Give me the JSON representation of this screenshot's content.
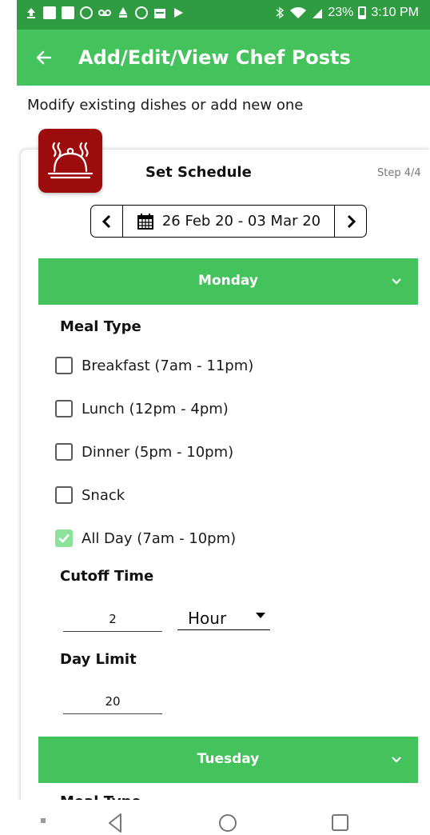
{
  "status_bar": {
    "battery": "23%",
    "time": "3:10 PM",
    "icons": [
      "upload-icon",
      "youtube-icon",
      "youtube-icon",
      "whatsapp-icon",
      "voicemail-icon",
      "app-icon",
      "smiley-icon",
      "calendar-icon",
      "play-store-icon",
      "bluetooth-icon",
      "wifi-icon",
      "signal-icon",
      "battery-icon"
    ]
  },
  "app_bar": {
    "title": "Add/Edit/View Chef Posts",
    "back_icon": "arrow-left-icon"
  },
  "subtitle": "Modify existing dishes or add new one",
  "card": {
    "logo_icon": "food-cloche-icon",
    "title": "Set Schedule",
    "step": "Step 4/4",
    "date_range": "26 Feb 20 - 03 Mar 20"
  },
  "days": [
    {
      "name": "Monday",
      "meal_type_label": "Meal Type",
      "meals": [
        {
          "label": "Breakfast (7am - 11pm)",
          "checked": false
        },
        {
          "label": "Lunch (12pm - 4pm)",
          "checked": false
        },
        {
          "label": "Dinner (5pm - 10pm)",
          "checked": false
        },
        {
          "label": "Snack",
          "checked": false
        },
        {
          "label": "All Day (7am - 10pm)",
          "checked": true
        }
      ],
      "cutoff_label": "Cutoff Time",
      "cutoff_value": "2",
      "cutoff_unit": "Hour",
      "limit_label": "Day Limit",
      "limit_value": "20"
    },
    {
      "name": "Tuesday",
      "peek_label": "Meal Type"
    }
  ],
  "colors": {
    "status_bar": "#2f9c42",
    "app_bar": "#44c25b",
    "day_header": "#44c25b",
    "logo_bg": "#9d0c0c",
    "checkbox_checked": "#8de29a"
  }
}
